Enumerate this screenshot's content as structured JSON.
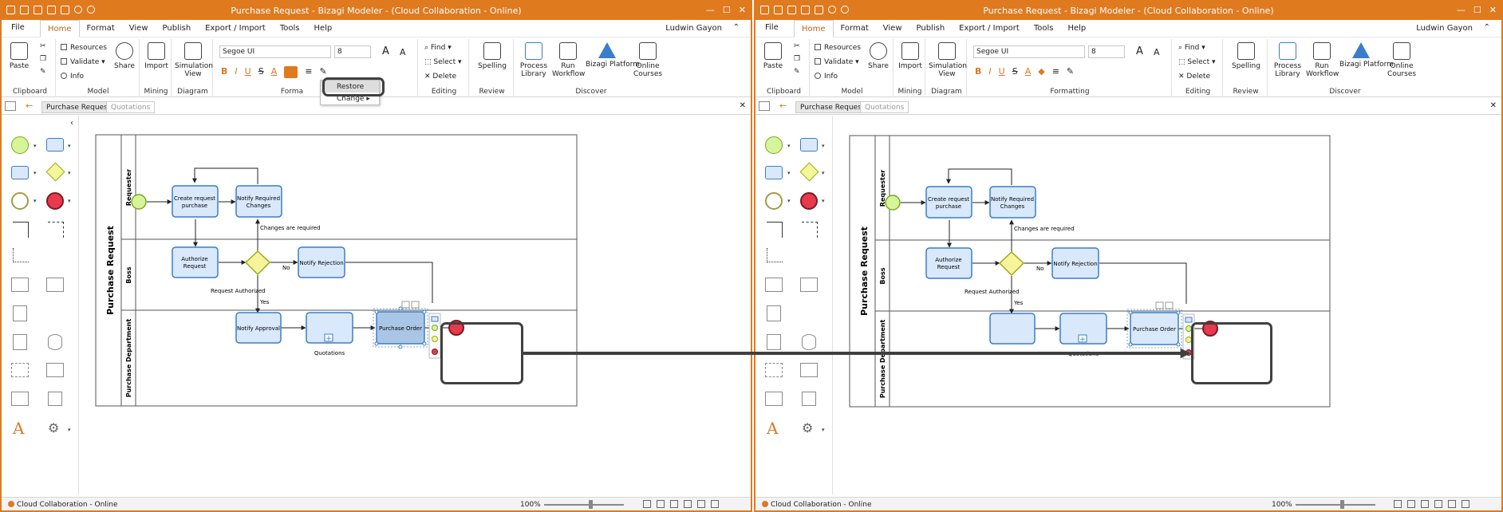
{
  "window_title": "Purchase Request - Bizagi Modeler - (Cloud Collaboration - Online)",
  "user_name": "Ludwin Gayon",
  "menu": {
    "file": "File",
    "tabs": [
      "Home",
      "Format",
      "View",
      "Publish",
      "Export / Import",
      "Tools",
      "Help"
    ],
    "active": "Home"
  },
  "ribbon": {
    "clipboard": {
      "label": "Clipboard",
      "paste": "Paste"
    },
    "model": {
      "label": "Model",
      "resources": "Resources",
      "validate": "Validate",
      "info": "Info",
      "share": "Share"
    },
    "mining": {
      "label": "Mining",
      "import": "Import"
    },
    "diagram": {
      "label": "Diagram",
      "simulation": "Simulation View"
    },
    "formatting": {
      "label": "Formatting",
      "label_left_visible": "Forma",
      "font_name": "Segoe UI",
      "font_size": "8"
    },
    "editing": {
      "label": "Editing",
      "find": "Find",
      "select": "Select",
      "delete": "Delete"
    },
    "review": {
      "label": "Review",
      "spelling": "Spelling"
    },
    "discover": {
      "label": "Discover",
      "process_library": "Process Library",
      "run_workflow": "Run Workflow",
      "bizagi_platform": "Bizagi Platform",
      "online_courses": "Online Courses"
    }
  },
  "popup_menu": {
    "items": [
      "Restore",
      "Change"
    ]
  },
  "doc_tabs": {
    "active": "Purchase Request",
    "inactive": "Quotations"
  },
  "diagram": {
    "pool": "Purchase Request",
    "lanes": [
      "Requester",
      "Boss",
      "Purchase Department"
    ],
    "tasks": {
      "create_request": "Create request purchase",
      "notify_changes": "Notify Required Changes",
      "authorize": "Authorize Request",
      "notify_rejection": "Notify Rejection",
      "notify_approval": "Notify Approval",
      "purchase_order": "Purchase Order",
      "subprocess_label": "Quotations"
    },
    "flow_labels": {
      "changes_required": "Changes are required",
      "no": "No",
      "request_authorized": "Request Authorized",
      "yes": "Yes"
    }
  },
  "status": {
    "text": "Cloud Collaboration - Online",
    "zoom": "100%"
  },
  "colors": {
    "brand": "#e07a1f",
    "task_fill": "#d9e9fb",
    "task_stroke": "#3a7dc9",
    "start_fill": "#d6f59a",
    "end_fill": "#e8394d",
    "gateway_fill": "#f7f49c"
  }
}
